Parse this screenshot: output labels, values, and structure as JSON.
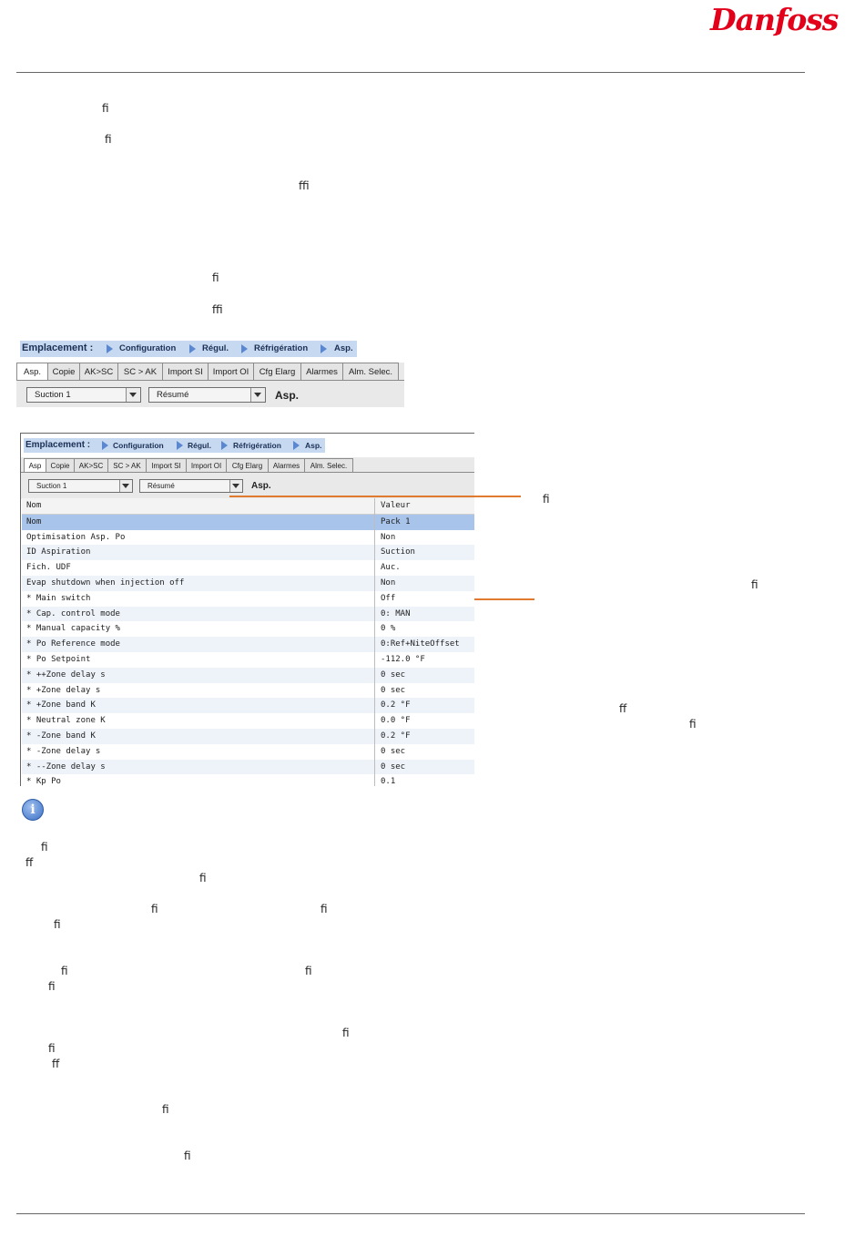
{
  "brand": {
    "logo_text": "Danfoss",
    "logo_color": "#e2001a"
  },
  "ligatures": [
    {
      "text": "ﬁ"
    },
    {
      "text": "ﬁ"
    },
    {
      "text": "ﬃ"
    },
    {
      "text": "ﬁ"
    },
    {
      "text": "ﬃ"
    },
    {
      "text": "ﬁ"
    },
    {
      "text": "ﬁ"
    },
    {
      "text": "ﬀ"
    },
    {
      "text": "ﬁ"
    },
    {
      "text": "ﬁ"
    },
    {
      "text": "ﬀ"
    },
    {
      "text": "ﬁ"
    },
    {
      "text": "ﬁ"
    },
    {
      "text": "ﬁ"
    },
    {
      "text": "ﬁ"
    },
    {
      "text": "ﬁ"
    },
    {
      "text": "ﬁ"
    },
    {
      "text": "ﬁ"
    },
    {
      "text": "ﬁ"
    },
    {
      "text": "ﬁ"
    },
    {
      "text": "ﬀ"
    },
    {
      "text": "ﬁ"
    },
    {
      "text": "ﬁ"
    }
  ],
  "location": {
    "label": "Emplacement :",
    "crumbs": [
      "Configuration",
      "Régul.",
      "Réfrigération",
      "Asp."
    ]
  },
  "tabs": [
    "Asp.",
    "Copie",
    "AK>SC",
    "SC > AK",
    "Import SI",
    "Import OI",
    "Cfg Elarg",
    "Alarmes",
    "Alm. Selec."
  ],
  "tabs_panel2": [
    "Asp",
    "Copie",
    "AK>SC",
    "SC > AK",
    "Import SI",
    "Import OI",
    "Cfg Elarg",
    "Alarmes",
    "Alm. Selec."
  ],
  "selectors": {
    "suction": "Suction 1",
    "view": "Résumé",
    "page": "Asp."
  },
  "table": {
    "headers": [
      "Nom",
      "Valeur"
    ],
    "rows": [
      [
        "Nom",
        "Pack 1"
      ],
      [
        "Optimisation Asp. Po",
        "Non"
      ],
      [
        "ID Aspiration",
        "Suction"
      ],
      [
        "Fich. UDF",
        "Auc."
      ],
      [
        "Evap shutdown when injection off",
        "Non"
      ],
      [
        "* Main switch",
        "Off"
      ],
      [
        "* Cap. control mode",
        "0: MAN"
      ],
      [
        "* Manual capacity %",
        "0 %"
      ],
      [
        "* Po Reference mode",
        "0:Ref+NiteOffset"
      ],
      [
        "* Po Setpoint",
        "-112.0 °F"
      ],
      [
        "* ++Zone delay s",
        "0 sec"
      ],
      [
        "* +Zone delay s",
        "0 sec"
      ],
      [
        "* +Zone band K",
        "0.2 °F"
      ],
      [
        "* Neutral zone K",
        "0.0 °F"
      ],
      [
        "* -Zone band K",
        "0.2 °F"
      ],
      [
        "* -Zone delay s",
        "0 sec"
      ],
      [
        "* --Zone delay s",
        "0 sec"
      ],
      [
        "* Kp Po",
        "0.1"
      ]
    ]
  },
  "info_icon_glyph": "i",
  "colors": {
    "accent_orange": "#e07a2e",
    "crumb_blue": "#5b87d1",
    "selected_row": "#a8c4ea"
  }
}
